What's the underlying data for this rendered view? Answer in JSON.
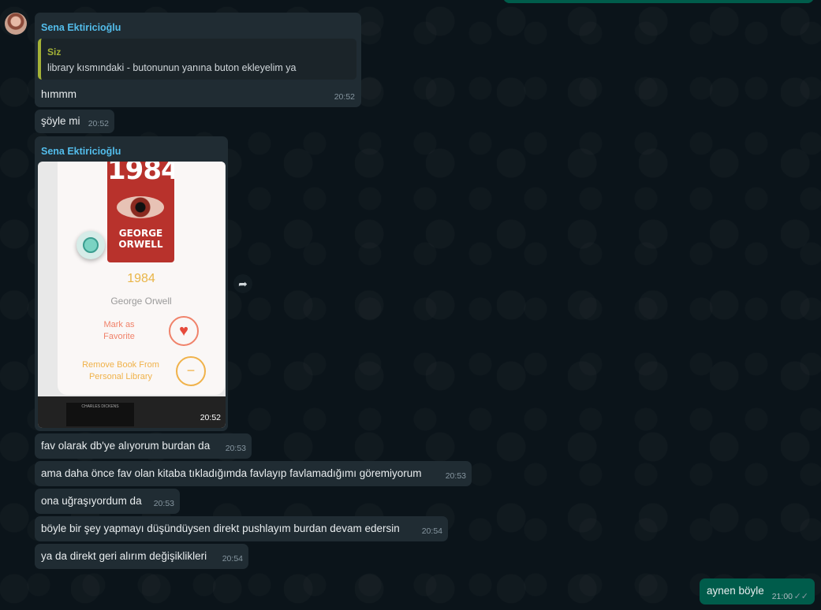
{
  "chat": {
    "sender_name": "Sena Ektiricioğlu",
    "quoted": {
      "author": "Siz",
      "text": "library kısmındaki - butonunun yanına buton ekleyelim ya"
    },
    "messages": [
      {
        "text": "hımmm",
        "time": "20:52"
      },
      {
        "text": "şöyle mi",
        "time": "20:52"
      },
      {
        "image_time": "20:52"
      },
      {
        "text": "fav olarak db'ye alıyorum burdan da",
        "time": "20:53"
      },
      {
        "text": "ama daha önce fav olan kitaba tıkladığımda favlayıp favlamadığımı göremiyorum",
        "time": "20:53"
      },
      {
        "text": "ona uğraşıyordum da",
        "time": "20:53"
      },
      {
        "text": "böyle bir şey yapmayı düşündüysen direkt pushlayım burdan devam edersin",
        "time": "20:54"
      },
      {
        "text": "ya da direkt geri alırım değişiklikleri",
        "time": "20:54"
      }
    ],
    "outgoing": {
      "text": "aynen böyle",
      "time": "21:00",
      "status_icon": "double-check-icon"
    }
  },
  "image_card": {
    "cover_title": "1984",
    "cover_author": "GEORGE ORWELL",
    "book_title": "1984",
    "book_author": "George Orwell",
    "fav_label": "Mark as Favorite",
    "remove_label": "Remove Book From Personal Library",
    "mini_book": "CHARLES DICKENS"
  },
  "colors": {
    "background": "#0b141a",
    "incoming_bubble": "#202c33",
    "outgoing_bubble": "#005c4b",
    "sender_name": "#53bdeb",
    "quote_accent": "#a5b337",
    "book_title": "#e9b547",
    "favorite_accent": "#f0826a"
  }
}
